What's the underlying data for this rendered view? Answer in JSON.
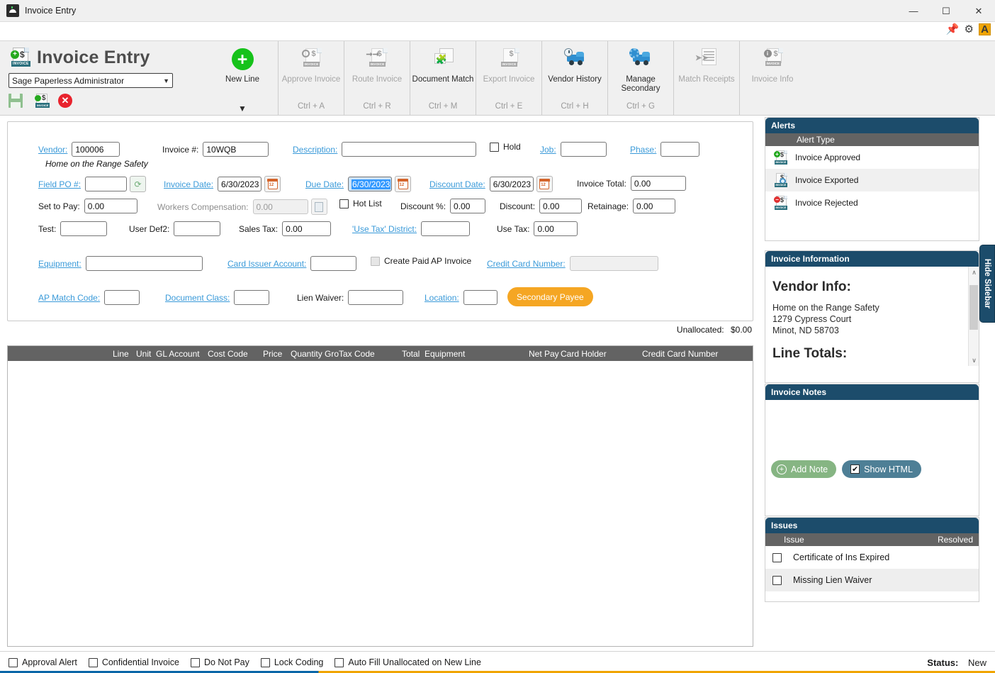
{
  "window": {
    "title": "Invoice Entry",
    "app_icon": "invoice-app-icon",
    "minimize": "—",
    "maximize": "☐",
    "close": "✕"
  },
  "substrip": {
    "pin": "📌",
    "gear": "⚙",
    "badge": "A"
  },
  "ribbon": {
    "heading": "Invoice Entry",
    "user_select": {
      "value": "Sage Paperless Administrator",
      "chevron": "▼"
    },
    "quick": [
      {
        "name": "save-icon",
        "label": "Save"
      },
      {
        "name": "save-invoice-icon",
        "label": "Save Invoice"
      },
      {
        "name": "cancel-icon",
        "label": "Cancel"
      }
    ],
    "buttons": [
      {
        "label": "New Line",
        "shortcut": "",
        "caret": "▼",
        "disabled": false
      },
      {
        "label": "Approve Invoice",
        "shortcut": "Ctrl + A",
        "disabled": true
      },
      {
        "label": "Route Invoice",
        "shortcut": "Ctrl + R",
        "disabled": true
      },
      {
        "label": "Document Match",
        "shortcut": "Ctrl + M",
        "disabled": false
      },
      {
        "label": "Export Invoice",
        "shortcut": "Ctrl + E",
        "disabled": true
      },
      {
        "label": "Vendor History",
        "shortcut": "Ctrl + H",
        "disabled": false
      },
      {
        "label": "Manage Secondary",
        "shortcut": "Ctrl + G",
        "disabled": false
      },
      {
        "label": "Match Receipts",
        "shortcut": "",
        "disabled": true
      },
      {
        "label": "Invoice Info",
        "shortcut": "",
        "disabled": true
      }
    ]
  },
  "form": {
    "vendor_label": "Vendor:",
    "vendor_value": "100006",
    "vendor_name": "Home on the Range Safety",
    "invoice_num_label": "Invoice #:",
    "invoice_num_value": "10WQB",
    "description_label": "Description:",
    "description_value": "",
    "hold_label": "Hold",
    "job_label": "Job:",
    "job_value": "",
    "phase_label": "Phase:",
    "phase_value": "",
    "field_po_label": "Field PO #:",
    "field_po_value": "",
    "invoice_date_label": "Invoice Date:",
    "invoice_date_value": "6/30/2023",
    "due_date_label": "Due Date:",
    "due_date_value": "6/30/2023",
    "discount_date_label": "Discount Date:",
    "discount_date_value": "6/30/2023",
    "invoice_total_label": "Invoice Total:",
    "invoice_total_value": "0.00",
    "set_to_pay_label": "Set to Pay:",
    "set_to_pay_value": "0.00",
    "workers_comp_label": "Workers Compensation:",
    "workers_comp_value": "0.00",
    "hot_list_label": "Hot List",
    "discount_pct_label": "Discount %:",
    "discount_pct_value": "0.00",
    "discount_label": "Discount:",
    "discount_value": "0.00",
    "retainage_label": "Retainage:",
    "retainage_value": "0.00",
    "test_label": "Test:",
    "test_value": "",
    "user_def2_label": "User Def2:",
    "user_def2_value": "",
    "sales_tax_label": "Sales Tax:",
    "sales_tax_value": "0.00",
    "use_tax_district_label": "'Use Tax' District:",
    "use_tax_district_value": "",
    "use_tax_label": "Use Tax:",
    "use_tax_value": "0.00",
    "equipment_label": "Equipment:",
    "equipment_value": "",
    "card_issuer_label": "Card Issuer Account:",
    "card_issuer_value": "",
    "create_paid_ap_label": "Create Paid AP Invoice",
    "credit_card_number_label": "Credit Card Number:",
    "credit_card_number_value": "",
    "ap_match_code_label": "AP Match Code:",
    "ap_match_code_value": "",
    "document_class_label": "Document Class:",
    "document_class_value": "",
    "lien_waiver_label": "Lien Waiver:",
    "lien_waiver_value": "",
    "location_label": "Location:",
    "location_value": "",
    "secondary_payee_button": "Secondary Payee"
  },
  "grid": {
    "unallocated_label": "Unallocated:",
    "unallocated_value": "$0.00",
    "columns": [
      "Line",
      "Unit",
      "GL Account",
      "Cost Code",
      "Price",
      "Quantity",
      "Gro",
      "Tax Code",
      "Total",
      "Equipment",
      "Net Pay",
      "Card Holder",
      "Credit Card Number"
    ],
    "rows": []
  },
  "sidebar": {
    "hide_label": "Hide Sidebar",
    "alerts": {
      "title": "Alerts",
      "column": "Alert Type",
      "items": [
        {
          "label": "Invoice Approved",
          "icon": "invoice-approved-icon"
        },
        {
          "label": "Invoice Exported",
          "icon": "invoice-exported-icon"
        },
        {
          "label": "Invoice Rejected",
          "icon": "invoice-rejected-icon"
        }
      ]
    },
    "invoice_information": {
      "title": "Invoice Information",
      "vendor_heading": "Vendor Info:",
      "vendor_line1": "Home on the Range Safety",
      "vendor_line2": "1279 Cypress Court",
      "vendor_line3": "Minot, ND 58703",
      "line_totals_heading": "Line Totals:",
      "scroll_up": "∧",
      "scroll_down": "∨"
    },
    "invoice_notes": {
      "title": "Invoice Notes",
      "add_note_label": "Add Note",
      "show_html_label": "Show HTML",
      "show_html_checked": true,
      "body_text": ""
    },
    "issues": {
      "title": "Issues",
      "col_issue": "Issue",
      "col_resolved": "Resolved",
      "items": [
        {
          "label": "Certificate of Ins Expired",
          "resolved": false
        },
        {
          "label": "Missing Lien Waiver",
          "resolved": false
        }
      ]
    }
  },
  "statusbar": {
    "checkboxes": [
      {
        "label": "Approval Alert",
        "checked": false
      },
      {
        "label": "Confidential Invoice",
        "checked": false
      },
      {
        "label": "Do Not Pay",
        "checked": false
      },
      {
        "label": "Lock Coding",
        "checked": false
      },
      {
        "label": "Auto Fill Unallocated on New Line",
        "checked": false
      }
    ],
    "status_label": "Status:",
    "status_value": "New"
  },
  "colors": {
    "panel_header": "#1c4c6b",
    "grid_header": "#636363",
    "accent_orange": "#f5a623",
    "link_blue": "#3a9ad9",
    "green": "#16c21a"
  }
}
